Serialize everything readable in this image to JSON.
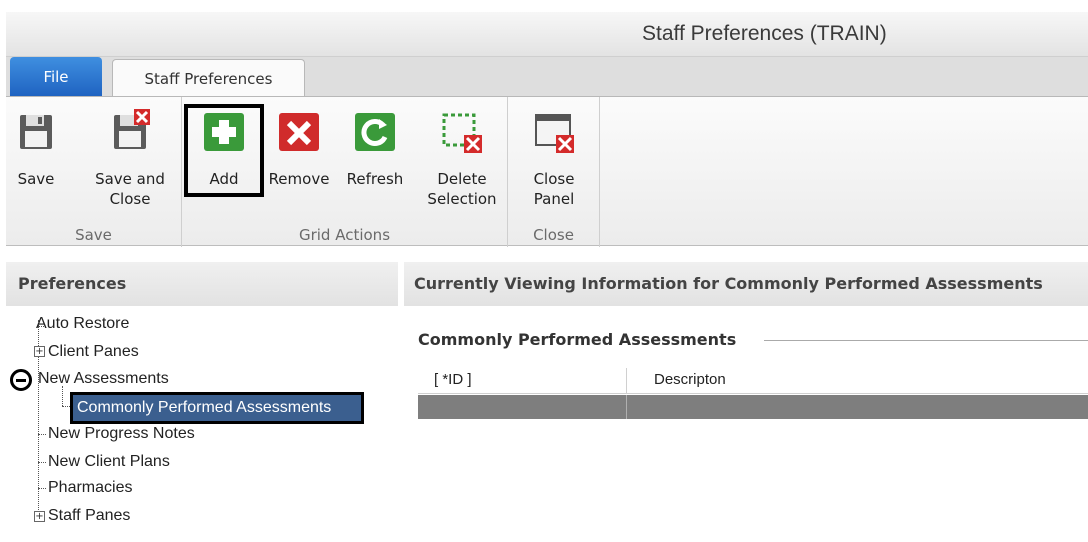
{
  "window": {
    "title": "Staff Preferences (TRAIN)"
  },
  "tabs": {
    "file_label": "File",
    "active_label": "Staff Preferences"
  },
  "ribbon": {
    "groups": [
      {
        "label": "Save",
        "buttons": [
          {
            "line1": "Save",
            "line2": ""
          },
          {
            "line1": "Save and",
            "line2": "Close"
          }
        ]
      },
      {
        "label": "Grid Actions",
        "buttons": [
          {
            "line1": "Add",
            "line2": ""
          },
          {
            "line1": "Remove",
            "line2": ""
          },
          {
            "line1": "Refresh",
            "line2": ""
          },
          {
            "line1": "Delete",
            "line2": "Selection"
          }
        ]
      },
      {
        "label": "Close",
        "buttons": [
          {
            "line1": "Close",
            "line2": "Panel"
          }
        ]
      }
    ]
  },
  "left_panel": {
    "header": "Preferences",
    "tree": [
      "Auto Restore",
      "Client Panes",
      "New Assessments",
      "Commonly Performed Assessments",
      "New Progress Notes",
      "New Client Plans",
      "Pharmacies",
      "Staff Panes"
    ]
  },
  "right_panel": {
    "header": "Currently Viewing Information for Commonly Performed Assessments",
    "section_title": "Commonly Performed Assessments",
    "grid": {
      "columns": [
        "[ *ID ]",
        "Descripton"
      ]
    }
  },
  "colors": {
    "file_tab": "#2a73d0",
    "selection": "#3b5f8f",
    "add_icon": "#3a9a3a",
    "remove_icon": "#d02b2b"
  }
}
